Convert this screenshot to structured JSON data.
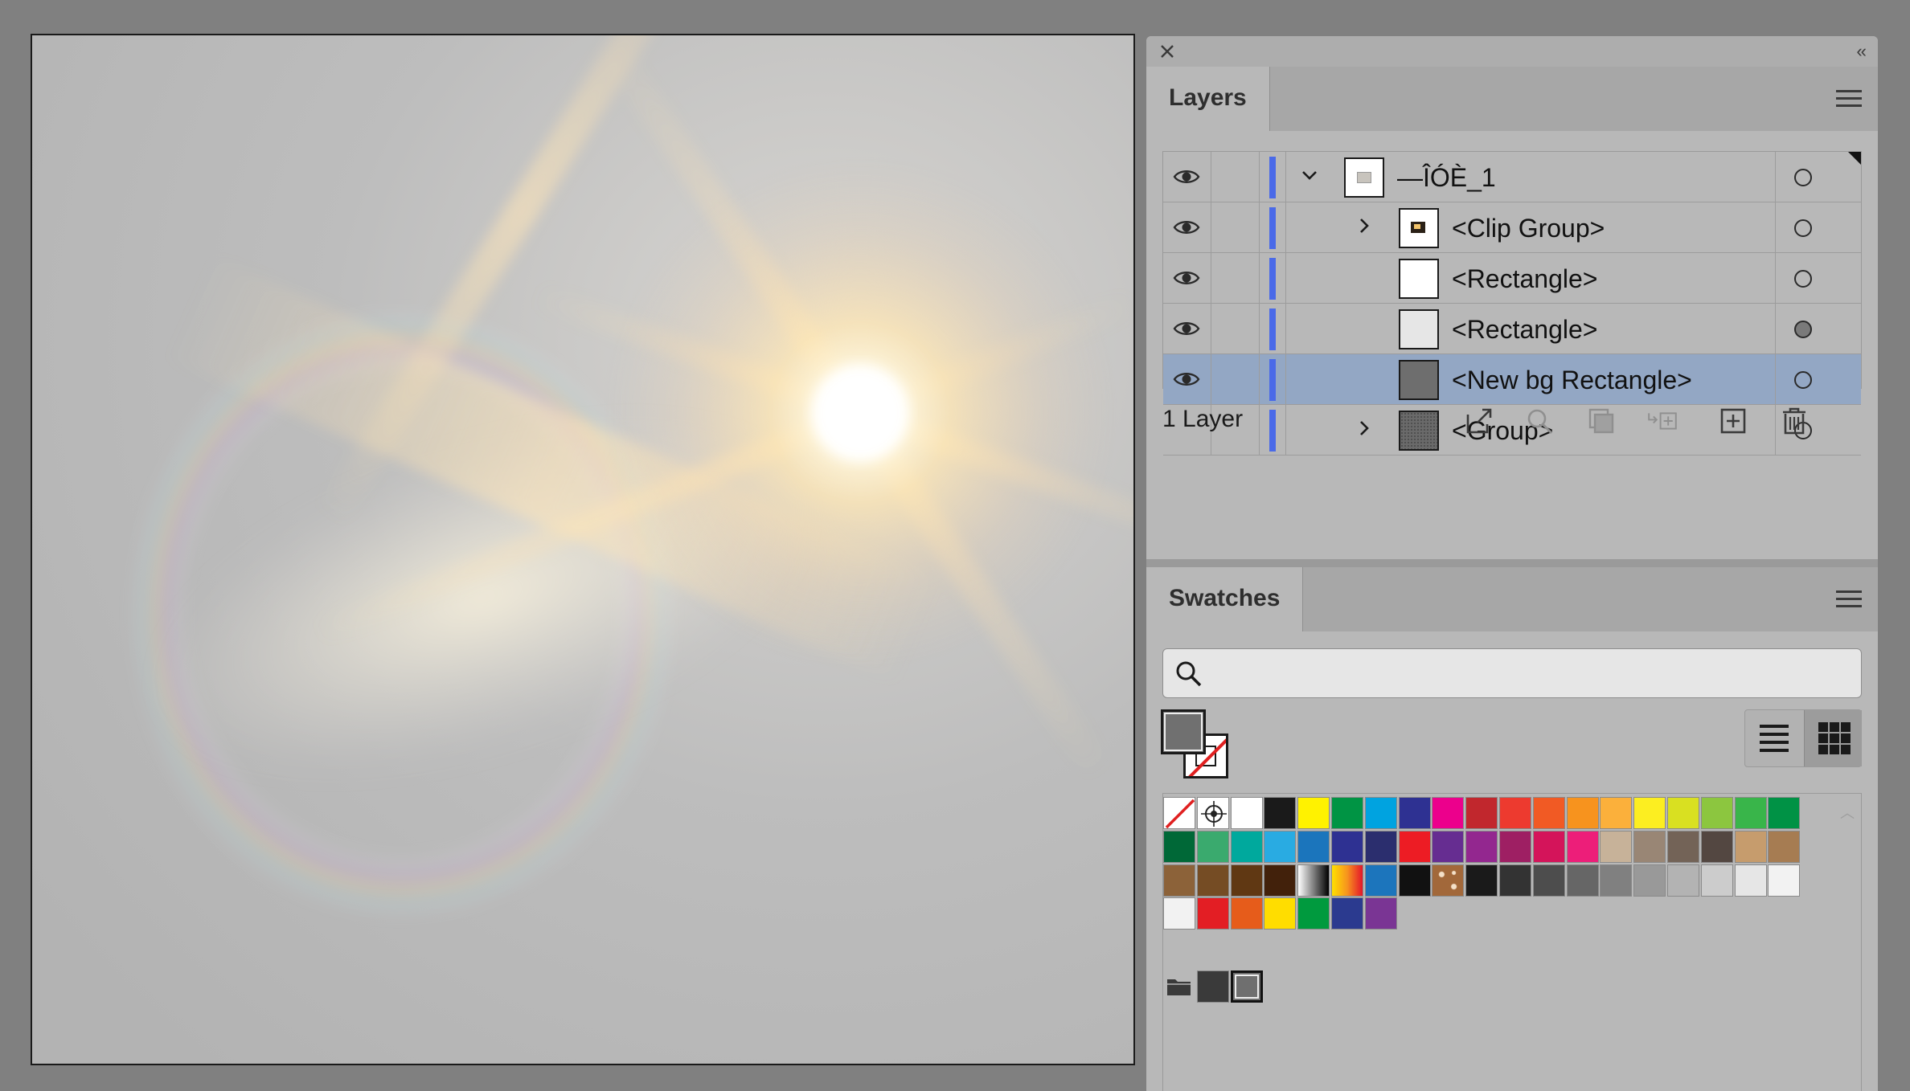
{
  "layers_panel": {
    "tab_label": "Layers",
    "rows": [
      {
        "name": "—ÎÓÈ_1",
        "level": 0,
        "expanded": true,
        "visible": true,
        "selected": false,
        "target_filled": false,
        "thumb": "image"
      },
      {
        "name": "<Clip Group>",
        "level": 1,
        "expanded": false,
        "visible": true,
        "selected": false,
        "target_filled": false,
        "thumb": "clip"
      },
      {
        "name": "<Rectangle>",
        "level": 1,
        "expanded": null,
        "visible": true,
        "selected": false,
        "target_filled": false,
        "thumb": "white"
      },
      {
        "name": "<Rectangle>",
        "level": 1,
        "expanded": null,
        "visible": true,
        "selected": false,
        "target_filled": true,
        "thumb": "lightgray"
      },
      {
        "name": "<New bg Rectangle>",
        "level": 1,
        "expanded": null,
        "visible": true,
        "selected": true,
        "target_filled": false,
        "thumb": "gray"
      },
      {
        "name": "<Group>",
        "level": 1,
        "expanded": false,
        "visible": false,
        "selected": false,
        "target_filled": false,
        "thumb": "pattern"
      }
    ],
    "layer_count": "1 Layer",
    "footer_icons": [
      "export-icon",
      "locate-object-icon",
      "make-clipping-mask-icon",
      "create-sublayer-icon",
      "new-layer-icon",
      "delete-icon"
    ],
    "layer_color": "#4a6ae8",
    "selection_color": "#93a7c4"
  },
  "swatches_panel": {
    "tab_label": "Swatches",
    "search_placeholder": "",
    "fill_color": "#707070",
    "stroke": "none",
    "view_modes": [
      "list-view-icon",
      "grid-view-icon"
    ],
    "active_view": "grid-view-icon",
    "rows": [
      [
        "none",
        "registration",
        "#ffffff",
        "#1a1a1a",
        "#fff200",
        "#009444",
        "#00a3e0",
        "#2e3192",
        "#ec008c",
        "#c1272d",
        "#ed3a2f",
        "#f15a24",
        "#f7931e",
        "#fbb03b",
        "#fcee21",
        "#d9e021",
        "#8cc63f",
        "#39b54a",
        "#009245"
      ],
      [
        "#006837",
        "#3aaa6e",
        "#00a99d",
        "#29abe2",
        "#1b75bc",
        "#2e3192",
        "#2b2e6e",
        "#ed1c24",
        "#662d91",
        "#93278f",
        "#9e1f63",
        "#d4145a",
        "#ed1e79",
        "#c7b299",
        "#998675",
        "#736357",
        "#534741",
        "#c69c6d",
        "#a67c52"
      ],
      [
        "#8c6239",
        "#754c24",
        "#603813",
        "#42210b",
        "gradient-bw",
        "gradient-orange",
        "#1c75bc",
        "#111111",
        "pattern-brown",
        "#1a1a1a",
        "#333333",
        "#4d4d4d",
        "#666666",
        "#808080",
        "#999999",
        "#b3b3b3",
        "#cccccc",
        "#e6e6e6",
        "#f2f2f2"
      ],
      [
        "#f2f2f2",
        "#e31e24",
        "#e65c1b",
        "#ffdd00",
        "#009a3e",
        "#2b3a8f",
        "#7a3594"
      ]
    ],
    "group_swatches": [
      "#3a3a3a",
      "#6f6f6f"
    ]
  }
}
